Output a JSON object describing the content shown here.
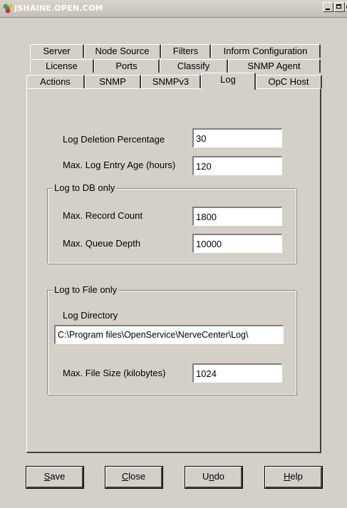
{
  "window": {
    "title": "JSHAINE.OPEN.COM"
  },
  "tabs": {
    "row1": [
      "Server",
      "Node Source",
      "Filters",
      "Inform Configuration"
    ],
    "row2": [
      "License",
      "Ports",
      "Classify",
      "SNMP Agent"
    ],
    "row3": [
      "Actions",
      "SNMP",
      "SNMPv3",
      "Log",
      "OpC Host"
    ],
    "active": "Log"
  },
  "log": {
    "deletion_pct_label": "Log Deletion Percentage",
    "deletion_pct_value": "30",
    "max_age_label": "Max. Log Entry Age (hours)",
    "max_age_value": "120",
    "db_group_title": "Log to DB only",
    "record_count_label": "Max. Record Count",
    "record_count_value": "1800",
    "queue_depth_label": "Max. Queue Depth",
    "queue_depth_value": "10000",
    "file_group_title": "Log to File only",
    "directory_label": "Log Directory",
    "directory_value": "C:\\Program files\\OpenService\\NerveCenter\\Log\\",
    "file_size_label": "Max. File Size (kilobytes)",
    "file_size_value": "1024"
  },
  "buttons": {
    "save": {
      "mnemonic": "S",
      "rest": "ave"
    },
    "close": {
      "mnemonic": "C",
      "rest": "lose"
    },
    "undo": {
      "pre": "U",
      "mnemonic": "n",
      "rest": "do"
    },
    "help": {
      "mnemonic": "H",
      "rest": "elp"
    }
  }
}
